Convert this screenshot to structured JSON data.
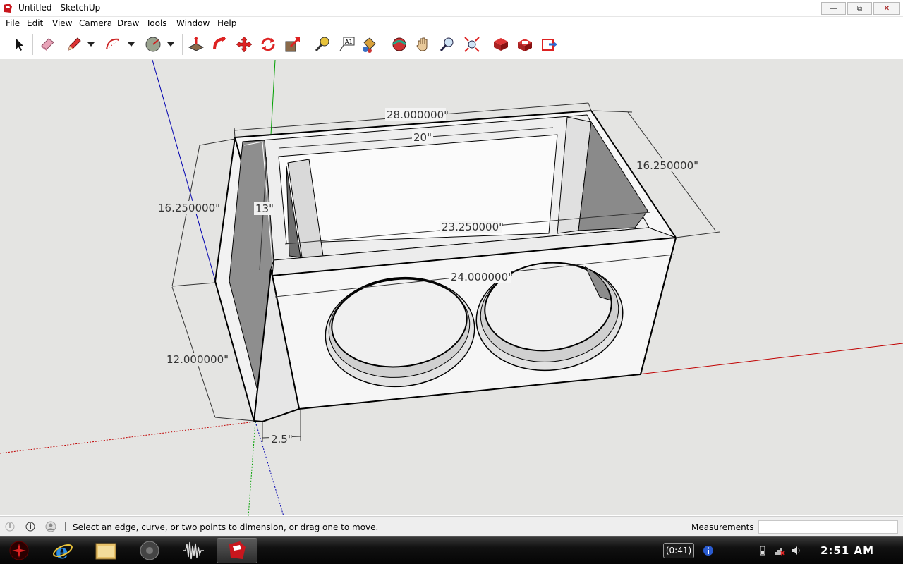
{
  "window": {
    "title": "Untitled - SketchUp",
    "icon": "sketchup-icon",
    "minimize_glyph": "—",
    "maximize_glyph": "⧉",
    "close_glyph": "✕"
  },
  "menu": {
    "items": [
      "File",
      "Edit",
      "View",
      "Camera",
      "Draw",
      "Tools",
      "Window",
      "Help"
    ]
  },
  "toolbar": {
    "tools": [
      "select-tool-icon",
      "eraser-tool-icon",
      "pencil-tool-icon",
      "arc-tool-icon",
      "circle-tool-icon",
      "push-pull-tool-icon",
      "follow-me-tool-icon",
      "move-tool-icon",
      "rotate-tool-icon",
      "scale-tool-icon",
      "tape-measure-tool-icon",
      "text-tool-icon",
      "paint-bucket-tool-icon",
      "orbit-tool-icon",
      "pan-tool-icon",
      "zoom-tool-icon",
      "zoom-extents-tool-icon",
      "get-models-icon",
      "share-model-icon",
      "send-to-layout-icon"
    ]
  },
  "model": {
    "dimensions": [
      "28.000000\"",
      "20\"",
      "16.250000\"",
      "16.250000\"",
      "13\"",
      "23.250000\"",
      "24.000000\"",
      "12.000000\"",
      "2.5\""
    ]
  },
  "status": {
    "hint": "Select an edge, curve, or two points to dimension, or drag one to move.",
    "measurements_label": "Measurements",
    "measurements_value": ""
  },
  "taskbar": {
    "apps": [
      "start-orb-icon",
      "internet-explorer-icon",
      "file-explorer-icon",
      "media-player-icon",
      "audio-editor-icon",
      "sketchup-icon"
    ],
    "battery_time": "(0:41)",
    "clock": "2:51 AM"
  },
  "colors": {
    "viewport_bg": "#e4e4e2",
    "axis_red": "#c00000",
    "axis_green": "#00a000",
    "axis_blue": "#0000b0"
  }
}
